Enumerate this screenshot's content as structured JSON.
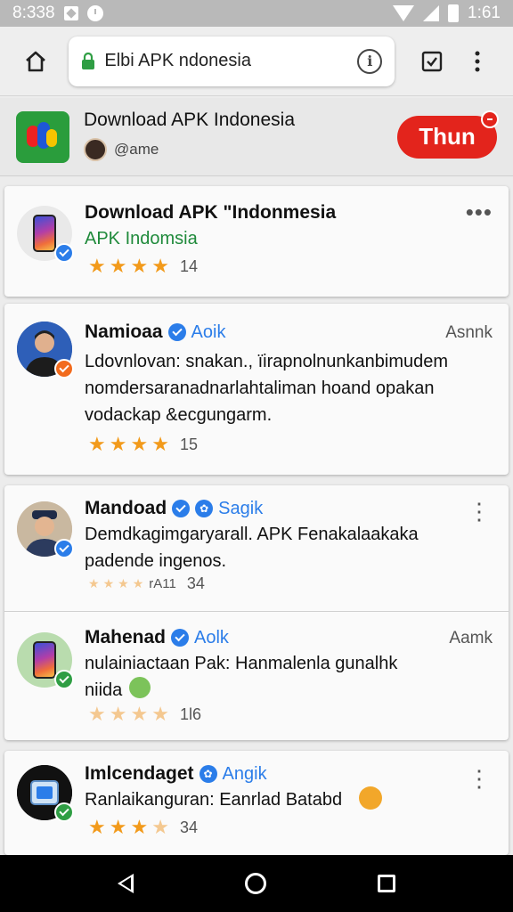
{
  "status_bar": {
    "time": "8:338",
    "battery_time": "1:61"
  },
  "browser": {
    "url_text": "Elbi APK ndonesia",
    "home_icon": "home-icon",
    "tabs_icon": "tab-check-icon",
    "menu_icon": "more-vert-icon"
  },
  "site_header": {
    "title": "Download APK Indonesia",
    "subtitle": "@ame",
    "cta_label": "Thun"
  },
  "cards": [
    {
      "name": "Download APK \"Indonmesia",
      "subtitle": "APK Indomsia",
      "stars": 4,
      "rating": "14"
    },
    {
      "name": "Namioaa",
      "handle": "Aoik",
      "side": "Asnnk",
      "text": "Ldovnlovan: snakan., ïirapnolnunkanbimudem nomdersaranadnarlahtaliman hoand opakan vodackap &ecgungarm.",
      "stars": 4,
      "rating": "15"
    },
    {
      "name": "Mandoad",
      "handle": "Sagik",
      "text": "Demdkagimgaryarall. APK Fenakalaakaka padende ingenos.",
      "rating_label": "rA11",
      "rating": "34"
    },
    {
      "name": "Mahenad",
      "handle": "Aolk",
      "side": "Aamk",
      "text": "nulainiactaan Pak: Hanmalenla gunalhk niida",
      "stars": 4,
      "rating": "1l6"
    },
    {
      "name": "Imlcendaget",
      "handle": "Angik",
      "text": "Ranlaikanguran: Eanrlad Batabd",
      "stars": 4,
      "rating": "34"
    }
  ],
  "colors": {
    "accent_blue": "#2b7de9",
    "cta_red": "#e3241c",
    "star": "#f29a1b",
    "green": "#2a9d3c"
  }
}
